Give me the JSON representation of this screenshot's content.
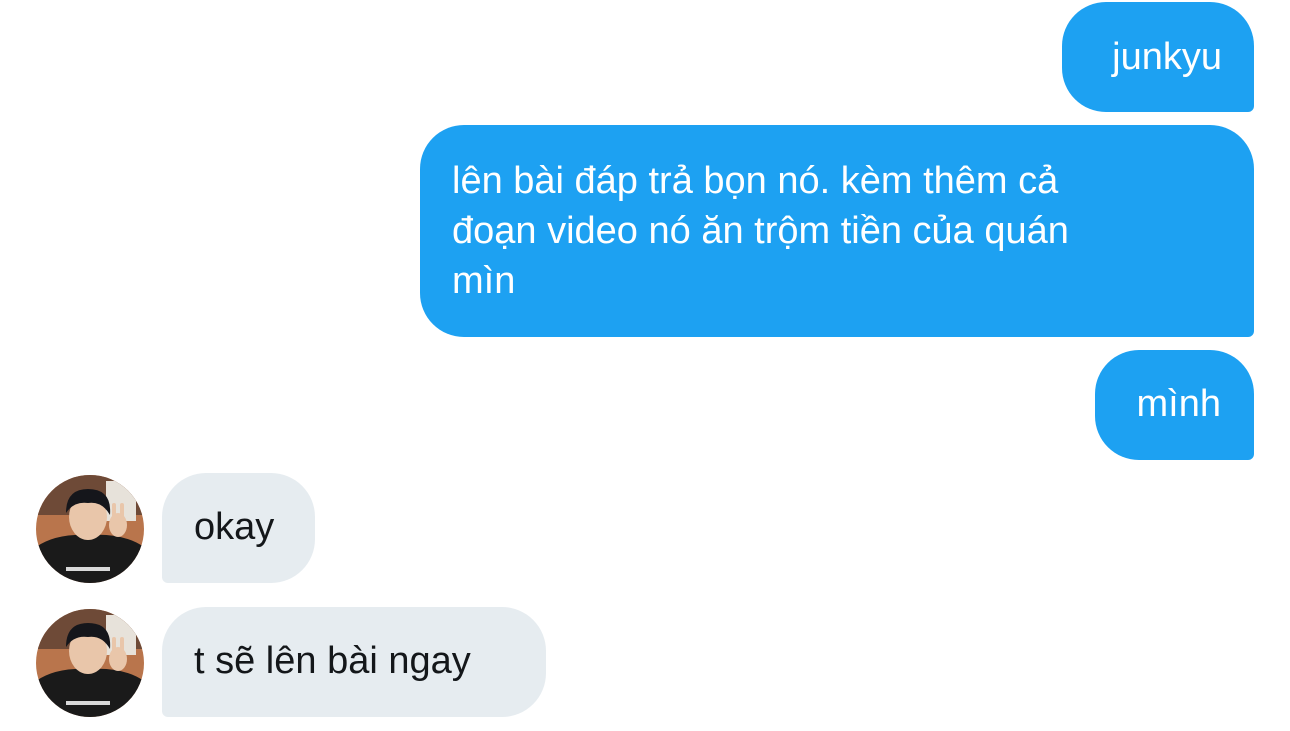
{
  "conversation": {
    "messages": [
      {
        "sender": "me",
        "text": "junkyu"
      },
      {
        "sender": "me",
        "text": "lên bài đáp trả bọn nó. kèm thêm cả\nđoạn video nó ăn trộm tiền của quán\nmìn"
      },
      {
        "sender": "me",
        "text": "mình"
      },
      {
        "sender": "other",
        "text": "okay"
      },
      {
        "sender": "other",
        "text": "t sẽ lên bài ngay"
      }
    ]
  },
  "colors": {
    "sent_bubble": "#1da1f2",
    "received_bubble": "#e6ecf0",
    "sent_text": "#ffffff",
    "received_text": "#14171a"
  }
}
